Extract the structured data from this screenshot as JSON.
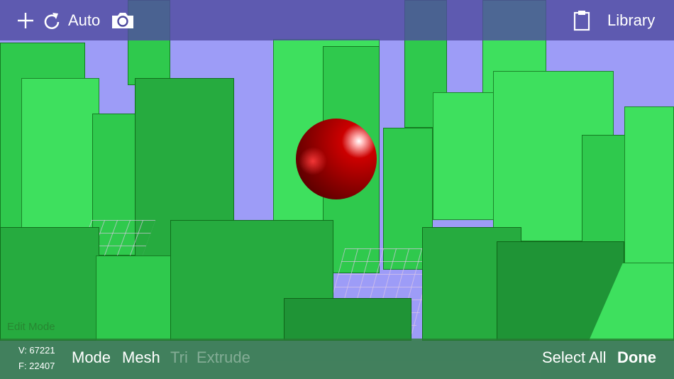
{
  "toolbar": {
    "auto_label": "Auto",
    "library_label": "Library"
  },
  "overlay": {
    "edit_mode": "Edit Mode"
  },
  "stats": {
    "vertices": "V: 67221",
    "faces": "F: 22407"
  },
  "bottom": {
    "mode": "Mode",
    "mesh": "Mesh",
    "tri": "Tri",
    "extrude": "Extrude",
    "select_all": "Select All",
    "done": "Done"
  },
  "colors": {
    "sky": "#9d9cf7",
    "building": "#33d955",
    "sphere": "#c00000",
    "topbar": "#504ca0",
    "bottombar": "#287832"
  }
}
